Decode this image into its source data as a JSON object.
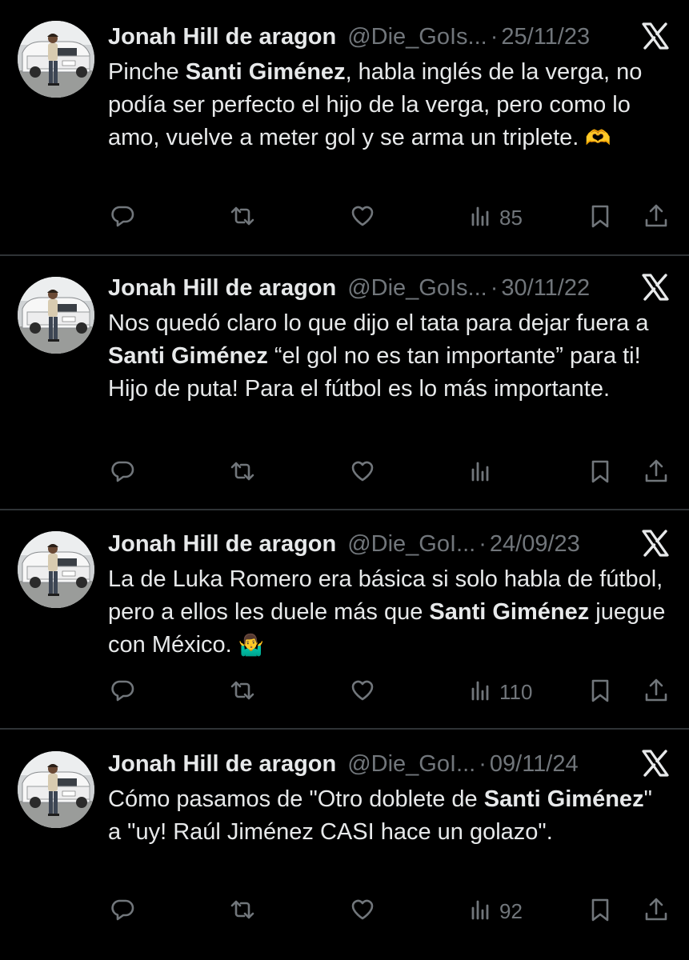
{
  "tweets": [
    {
      "name": "Jonah Hill de aragon",
      "handle": "@Die_GoIs...",
      "date": "25/11/23",
      "text_parts": [
        {
          "t": "Pinche ",
          "b": false
        },
        {
          "t": "Santi Giménez",
          "b": true
        },
        {
          "t": ", habla inglés de la verga, no podía ser perfecto el hijo de la verga, pero como lo amo, vuelve a meter gol y se arma un triplete. ",
          "b": false
        },
        {
          "t": "🫶",
          "b": false
        }
      ],
      "views": "85"
    },
    {
      "name": "Jonah Hill de aragon",
      "handle": "@Die_GoIs...",
      "date": "30/11/22",
      "text_parts": [
        {
          "t": "Nos quedó claro lo que dijo el tata para dejar fuera a ",
          "b": false
        },
        {
          "t": "Santi Giménez",
          "b": true
        },
        {
          "t": " “el gol no es tan importante” para ti! Hijo de puta! Para el fútbol es lo más importante.",
          "b": false
        }
      ],
      "views": ""
    },
    {
      "name": "Jonah Hill de aragon",
      "handle": "@Die_GoI...",
      "date": "24/09/23",
      "text_parts": [
        {
          "t": "La de Luka Romero era básica si solo habla de fútbol, pero a ellos les duele más que ",
          "b": false
        },
        {
          "t": "Santi Giménez",
          "b": true
        },
        {
          "t": " juegue con México. ",
          "b": false
        },
        {
          "t": "🤷‍♂️",
          "b": false
        }
      ],
      "views": "110"
    },
    {
      "name": "Jonah Hill de aragon",
      "handle": "@Die_GoI...",
      "date": "09/11/24",
      "text_parts": [
        {
          "t": "Cómo pasamos de \"Otro doblete de ",
          "b": false
        },
        {
          "t": "Santi Giménez",
          "b": true
        },
        {
          "t": "\" a \"uy! Raúl Jiménez CASI hace un golazo\".",
          "b": false
        }
      ],
      "views": "92"
    }
  ],
  "icons": {
    "reply": "reply-icon",
    "retweet": "retweet-icon",
    "like": "like-icon",
    "views": "views-icon",
    "bookmark": "bookmark-icon",
    "share": "share-icon",
    "brand": "x-logo-icon"
  },
  "colors": {
    "background": "#000000",
    "text": "#e7e9ea",
    "muted": "#71767b",
    "divider": "#2f3336"
  }
}
